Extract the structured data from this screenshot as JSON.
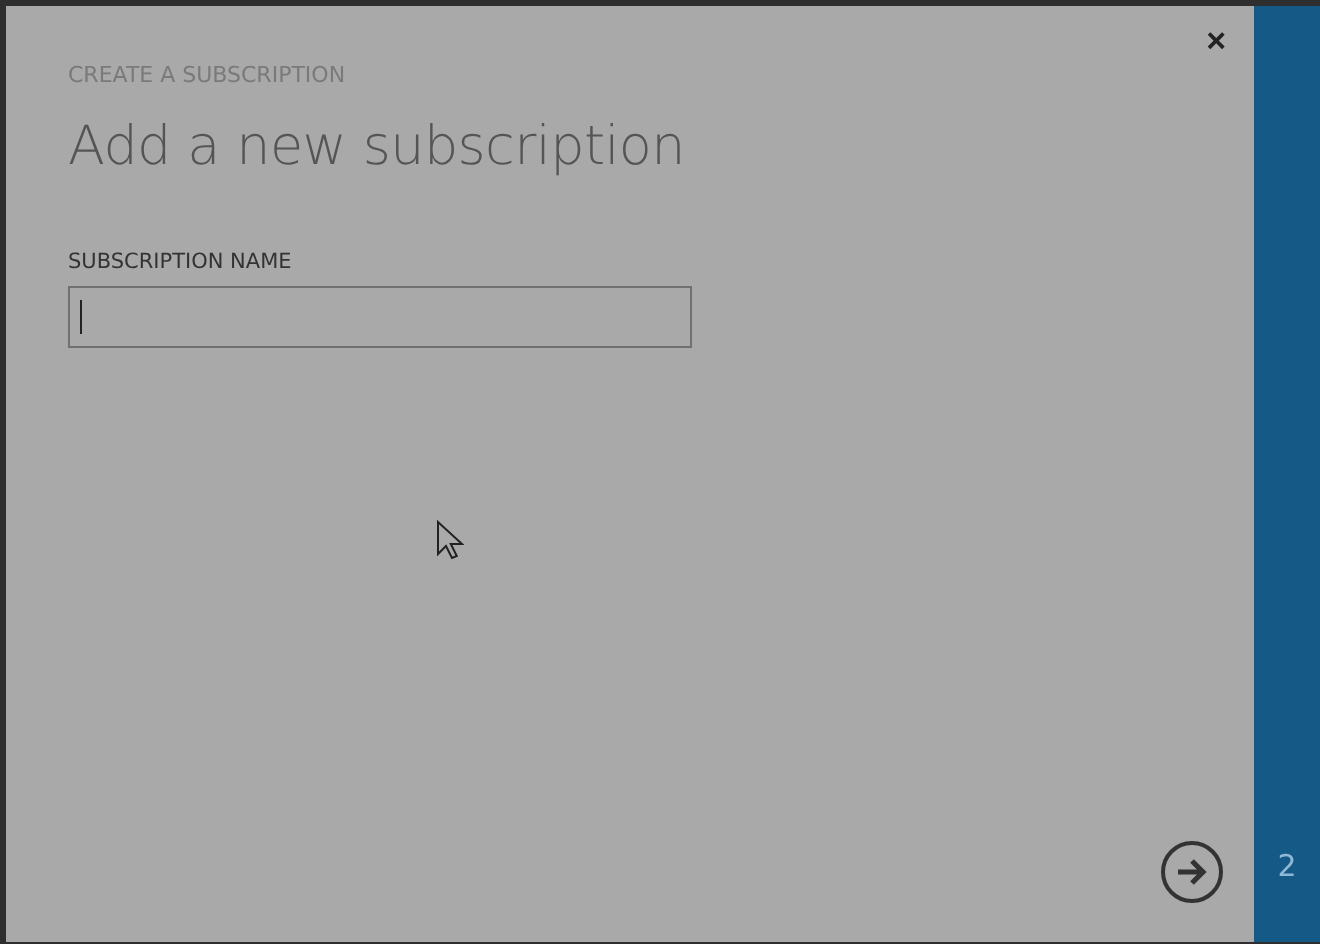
{
  "dialog": {
    "close": "×",
    "eyebrow": "CREATE A SUBSCRIPTION",
    "title": "Add a new subscription",
    "field": {
      "label": "SUBSCRIPTION NAME"
    }
  },
  "step": {
    "number": "2"
  }
}
